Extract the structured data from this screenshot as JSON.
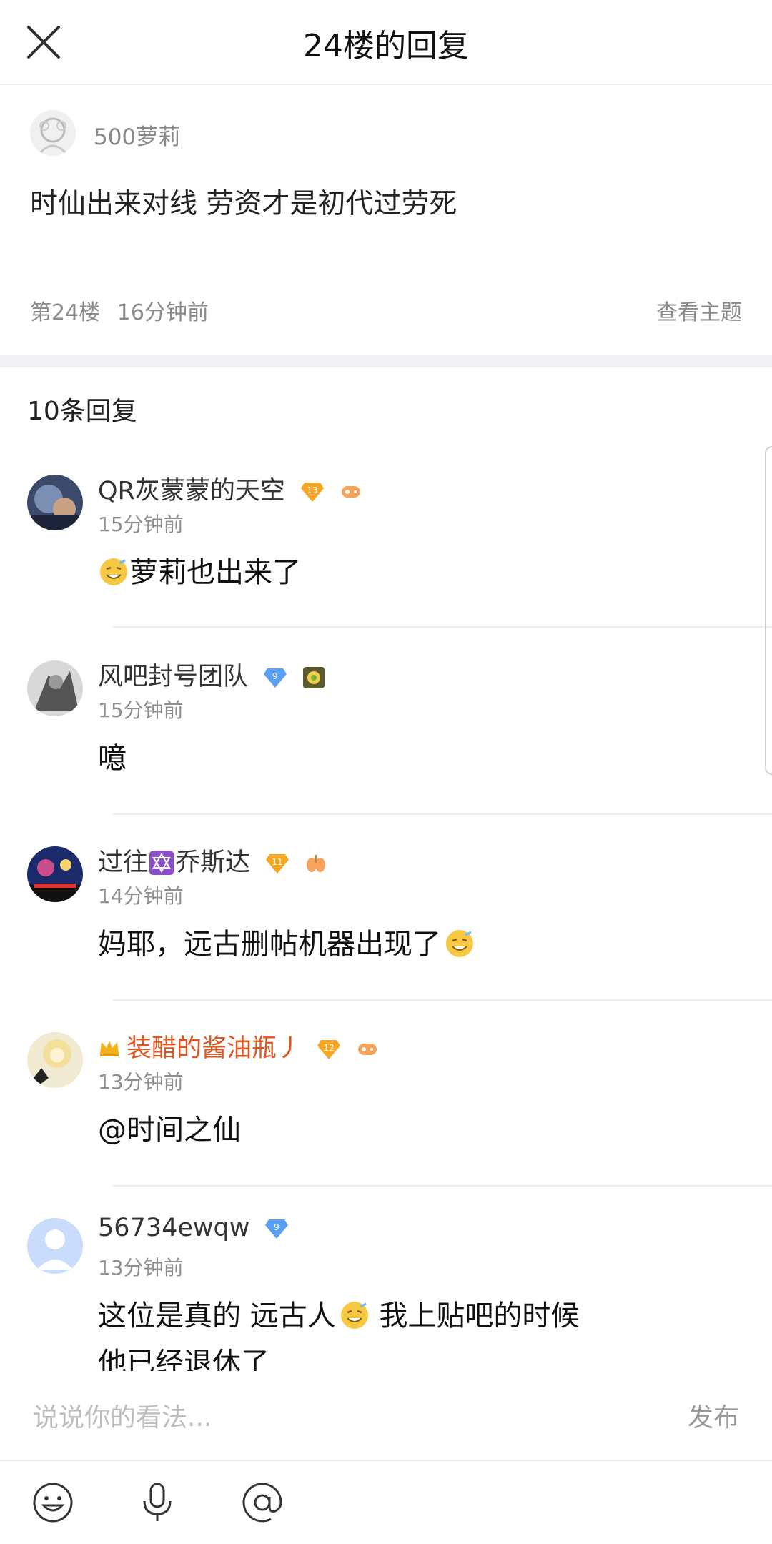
{
  "header": {
    "title": "24楼的回复"
  },
  "post": {
    "author": "500萝莉",
    "content": "时仙出来对线 劳资才是初代过劳死",
    "floor": "第24楼",
    "time": "16分钟前",
    "view_topic": "查看主题"
  },
  "reply_count": "10条回复",
  "replies": [
    {
      "name": "QR灰蒙蒙的天空",
      "level": "13",
      "time": "15分钟前",
      "text": "萝莉也出来了"
    },
    {
      "name": "风吧封号团队",
      "level": "9",
      "time": "15分钟前",
      "text": "噫"
    },
    {
      "name_a": "过往",
      "name_b": "乔斯达",
      "level": "11",
      "time": "14分钟前",
      "text": "妈耶，远古删帖机器出现了"
    },
    {
      "name": "装醋的酱油瓶丿",
      "level": "12",
      "time": "13分钟前",
      "text": "@时间之仙"
    },
    {
      "name": "56734ewqw",
      "level": "9",
      "time": "13分钟前",
      "text_line1_a": "这位是真的 远古人",
      "text_line1_b": " 我上贴吧的时候",
      "text_line2": "他已经退休了"
    }
  ],
  "input": {
    "placeholder": "说说你的看法...",
    "publish": "发布"
  },
  "colors": {
    "accent_blue": "#3a6bb3",
    "vip_orange": "#e0561e",
    "level_gold": "#f5a623",
    "level_blue": "#5aa0f2"
  }
}
